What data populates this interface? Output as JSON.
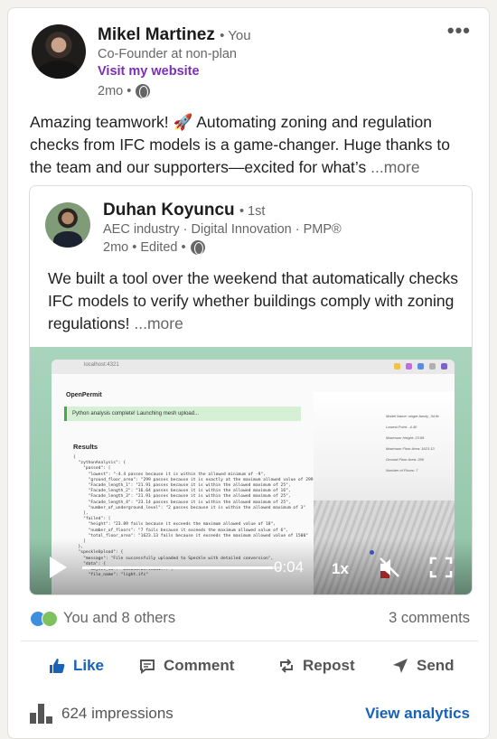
{
  "author": {
    "name": "Mikel Martinez",
    "you_tag": "• You",
    "headline": "Co-Founder at non-plan",
    "website_label": "Visit my website",
    "time": "2mo •"
  },
  "post": {
    "text": "Amazing teamwork! 🚀 Automating zoning and regulation checks from IFC models is a game-changer. Huge thanks to the team and our supporters—excited for what’s",
    "more": "...more"
  },
  "reshared": {
    "name": "Duhan Koyuncu",
    "degree": "• 1st",
    "headline": "AEC industry · Digital Innovation · PMP®",
    "time": "2mo • Edited •",
    "text": "We built a tool over the weekend that automatically checks IFC models to verify whether buildings comply with zoning regulations!",
    "more": "...more"
  },
  "video": {
    "url": "localhost:4321",
    "app_title": "OpenPermit",
    "banner": "Python analysis complete! Launching mesh upload...",
    "results_title": "Results",
    "time": "0:04",
    "speed": "1x",
    "progress": 0.96
  },
  "social": {
    "reactions_text": "You and 8 others",
    "comments_text": "3 comments"
  },
  "actions": {
    "like": "Like",
    "comment": "Comment",
    "repost": "Repost",
    "send": "Send"
  },
  "footer": {
    "impressions": "624 impressions",
    "analytics": "View analytics"
  },
  "icons": {
    "menu": "more-options-icon",
    "visibility": "globe-icon",
    "play": "play-icon",
    "mute": "mute-icon",
    "fullscreen": "fullscreen-icon",
    "stats": "bar-chart-icon"
  },
  "colors": {
    "link": "#1762b8",
    "website": "#7b2fb8",
    "video_bg": "#9ccbb1"
  }
}
